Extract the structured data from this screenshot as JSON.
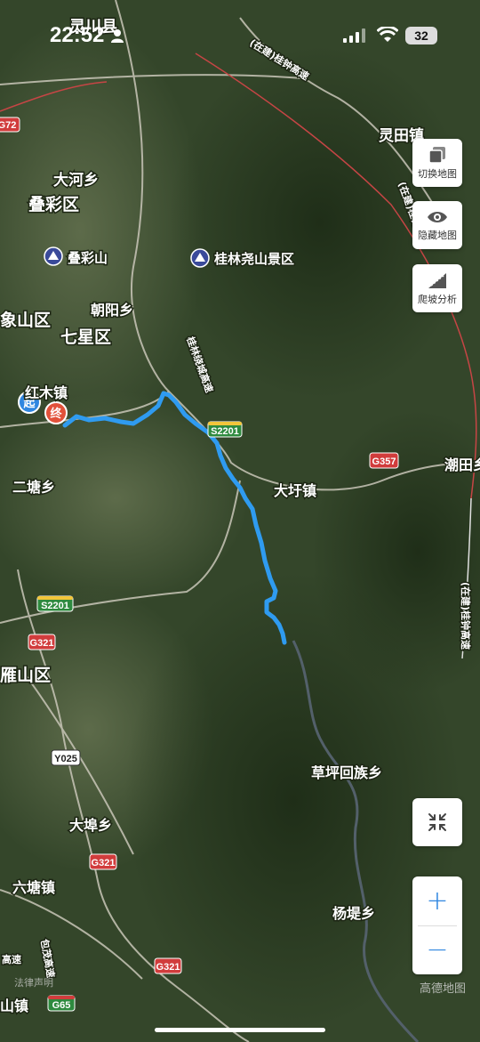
{
  "status_bar": {
    "time": "22:52",
    "battery": "32"
  },
  "controls": {
    "switch_map": "切换地图",
    "hide_map": "隐藏地图",
    "slope_analysis": "爬坡分析"
  },
  "zoom": {
    "in": "+",
    "out": "−"
  },
  "route": {
    "start_label": "起",
    "end_label": "终",
    "color": "#2f9bf0"
  },
  "map_labels": {
    "lingchuan": "灵川县",
    "lingtian": "灵田镇",
    "dahe": "大河乡",
    "diecai_qu": "叠彩区",
    "diecaishan": "叠彩山",
    "guilin_yaoshan": "桂林尧山景区",
    "chaoyang": "朝阳乡",
    "qixing": "七星区",
    "xiangshan": "象山区",
    "hongmu": "红木镇",
    "ertang": "二塘乡",
    "daxu": "大圩镇",
    "chaotian": "潮田乡",
    "yanshan": "雁山区",
    "caoping": "草坪回族乡",
    "dabu": "大埠乡",
    "liutang": "六塘镇",
    "yangdi": "杨堤乡",
    "shan_zhen": "山镇",
    "guizhong_expressway_top": "(在建)桂钟高速",
    "guizhong_expressway_right1": "(在建)桂钟高速",
    "guizhong_expressway_right2": "(在建)桂钟高速",
    "guilin_ring": "桂林绕城高速",
    "baoquan": "包茂高速",
    "gaosu": "高速"
  },
  "road_badges": {
    "g72": "G72",
    "s2201_a": "S2201",
    "s2201_b": "S2201",
    "g357": "G357",
    "g321_a": "G321",
    "g321_b": "G321",
    "g321_c": "G321",
    "y025": "Y025",
    "g65": "G65"
  },
  "watermark": "高德地图",
  "legal": "法律声明"
}
